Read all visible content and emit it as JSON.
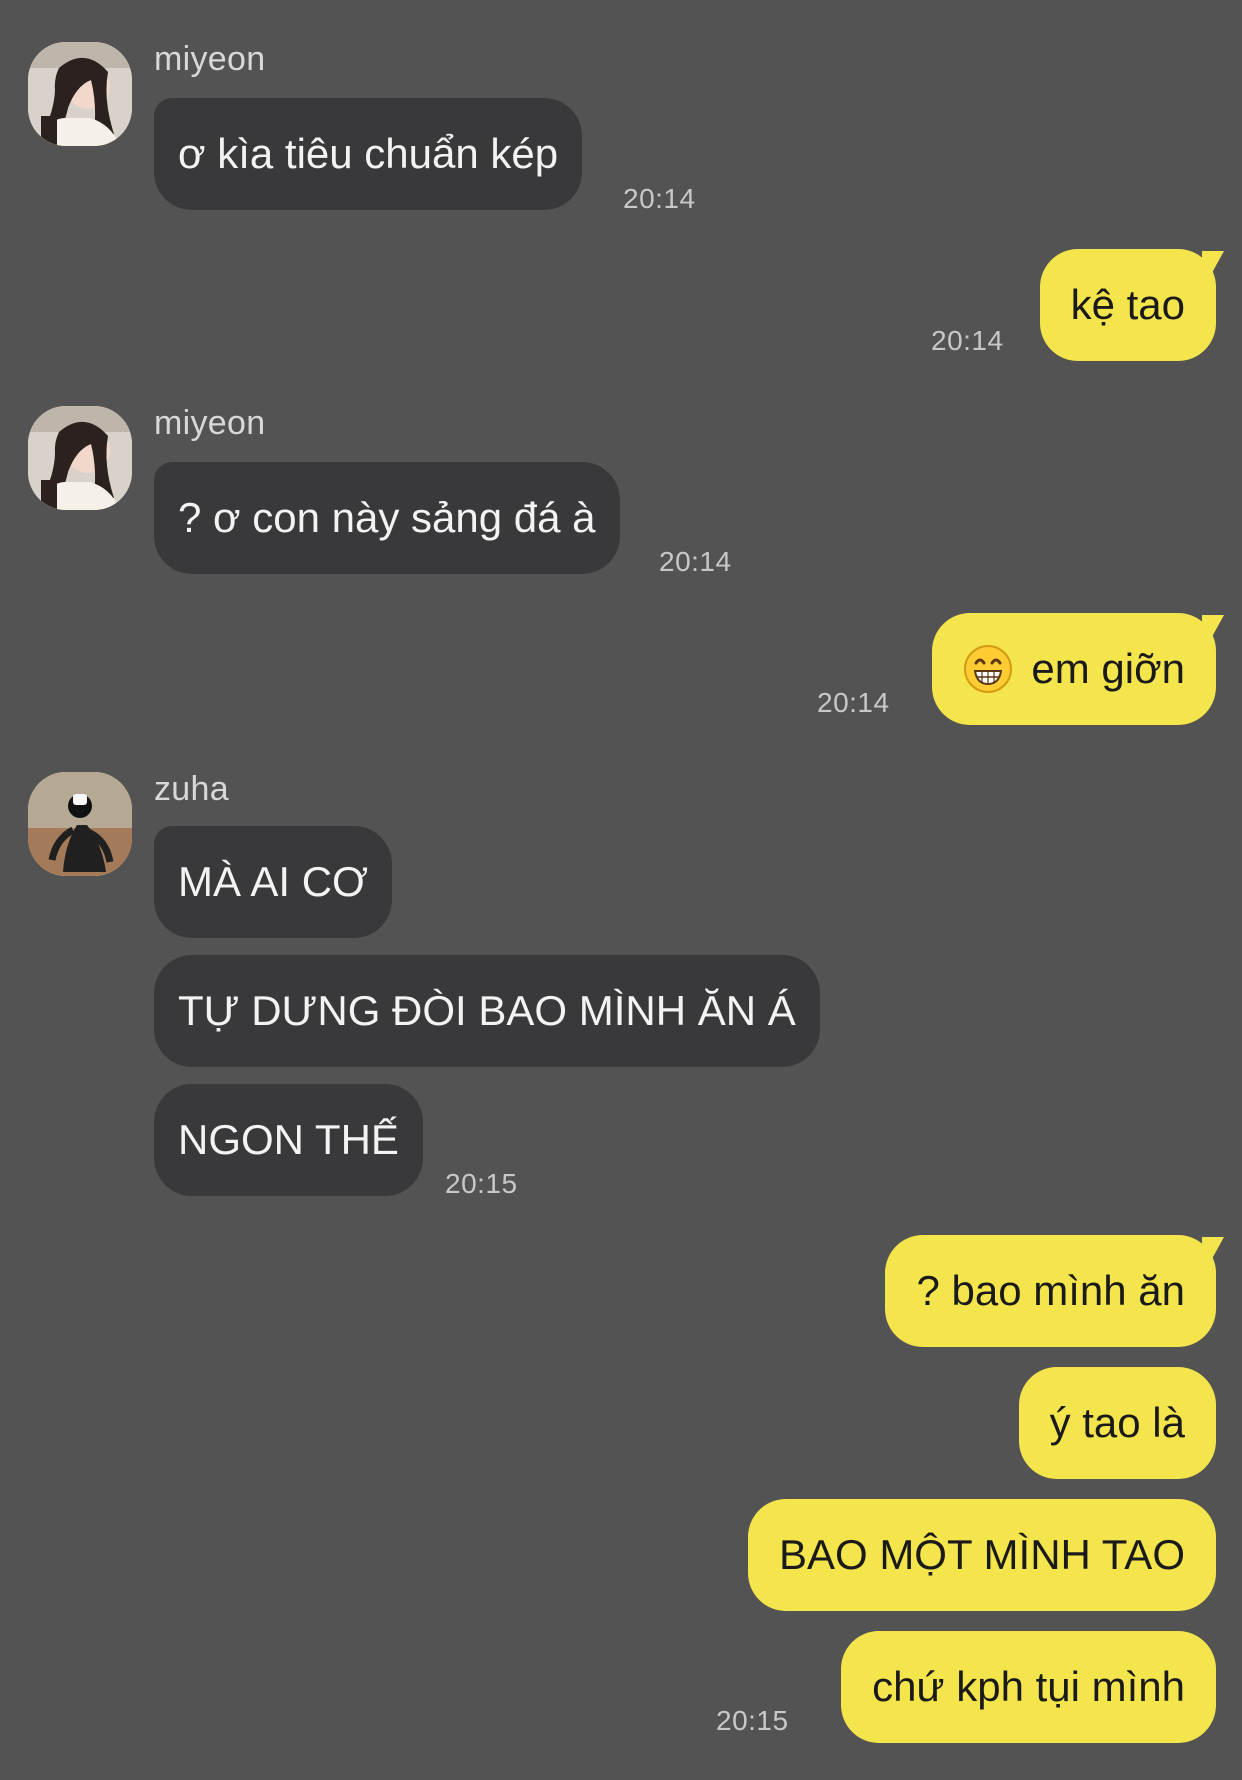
{
  "chat": {
    "messages": {
      "m1": {
        "sender": "miyeon",
        "text": "ơ kìa tiêu chuẩn kép",
        "time": "20:14"
      },
      "m2": {
        "text": "kệ tao",
        "time": "20:14"
      },
      "m3": {
        "sender": "miyeon",
        "text": "? ơ con này sảng đá à",
        "time": "20:14"
      },
      "m4": {
        "emoji": "grinning-face-icon",
        "text": "em giỡn",
        "time": "20:14"
      },
      "m5": {
        "sender": "zuha",
        "text": "MÀ AI CƠ"
      },
      "m6": {
        "text": "TỰ DƯNG ĐÒI BAO MÌNH ĂN Á"
      },
      "m7": {
        "text": "NGON THẾ",
        "time": "20:15"
      },
      "m8": {
        "text": "? bao mình ăn"
      },
      "m9": {
        "text": "ý tao là"
      },
      "m10": {
        "text": "BAO MỘT MÌNH TAO"
      },
      "m11": {
        "text": "chứ kph tụi mình",
        "time": "20:15"
      }
    }
  },
  "colors": {
    "background": "#545354",
    "incoming_bubble": "#39383b",
    "outgoing_bubble": "#f5e54c",
    "name_text": "#d8d8d8",
    "time_text": "#c8c8c8"
  }
}
